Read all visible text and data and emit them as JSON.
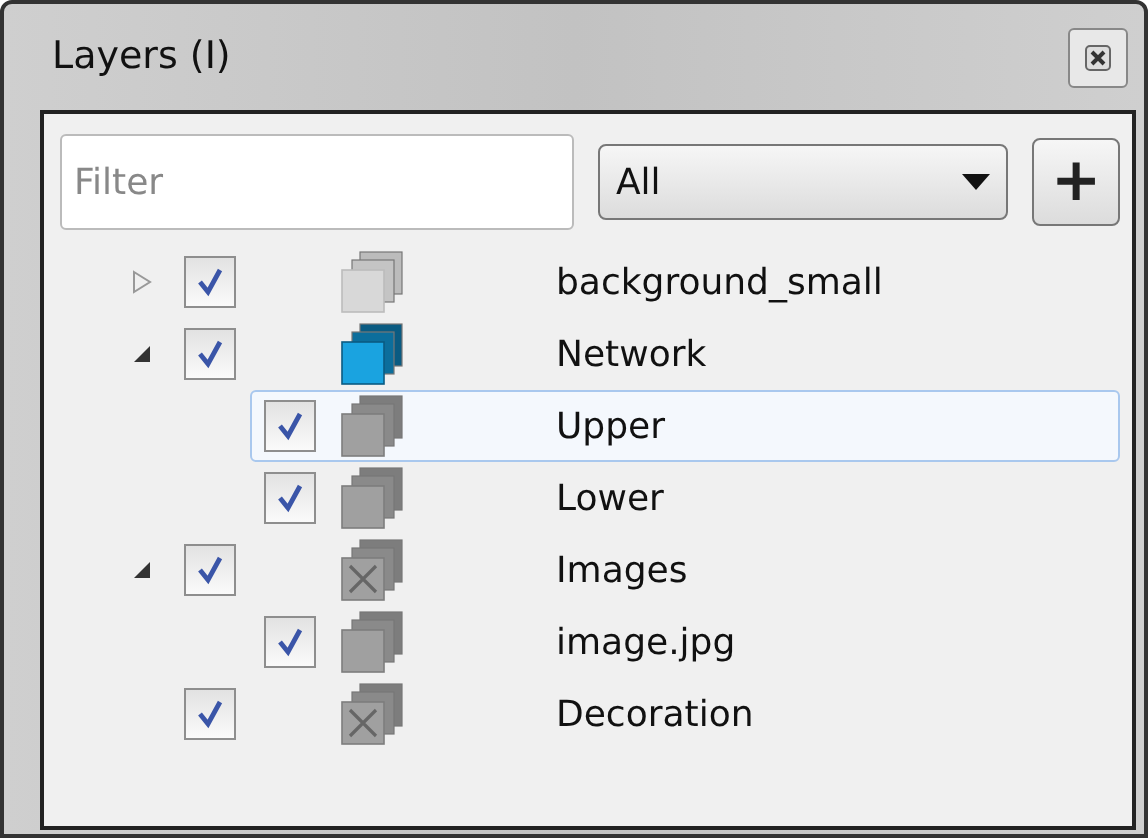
{
  "window": {
    "title": "Layers (I)"
  },
  "filter": {
    "placeholder": "Filter"
  },
  "type_dropdown": {
    "value": "All"
  },
  "add_button": {
    "label": "+"
  },
  "layers": [
    {
      "name": "background_small",
      "checked": true,
      "selected": false,
      "expanded": false,
      "kind": "faded-layer"
    },
    {
      "name": "Network",
      "checked": true,
      "selected": false,
      "expanded": true,
      "kind": "active-layer",
      "children": [
        {
          "name": "Upper",
          "checked": true,
          "selected": true,
          "kind": "layer"
        },
        {
          "name": "Lower",
          "checked": true,
          "selected": false,
          "kind": "layer"
        }
      ]
    },
    {
      "name": "Images",
      "checked": true,
      "selected": false,
      "expanded": true,
      "kind": "missing-layer",
      "children": [
        {
          "name": "image.jpg",
          "checked": true,
          "selected": false,
          "kind": "layer"
        }
      ]
    },
    {
      "name": "Decoration",
      "checked": true,
      "selected": false,
      "kind": "missing-layer"
    }
  ]
}
